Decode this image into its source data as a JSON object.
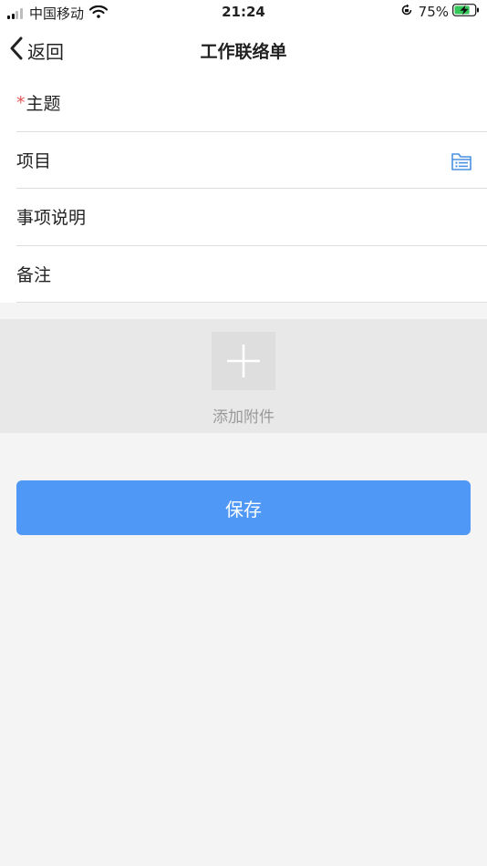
{
  "status_bar": {
    "carrier": "中国移动",
    "time": "21:24",
    "battery_percent": "75%",
    "battery_level": 0.75,
    "icons": [
      "signal-icon",
      "wifi-icon",
      "rotation-lock-icon",
      "battery-charging-icon"
    ]
  },
  "nav": {
    "back_label": "返回",
    "title": "工作联络单"
  },
  "form": {
    "subject": {
      "required_mark": "*",
      "label": "主题"
    },
    "project": {
      "label": "项目",
      "icon": "list-file-icon"
    },
    "description": {
      "label": "事项说明"
    },
    "remarks": {
      "label": "备注"
    }
  },
  "attachment": {
    "label": "添加附件",
    "icon": "plus-icon"
  },
  "actions": {
    "save_label": "保存"
  },
  "colors": {
    "accent": "#5098f5",
    "background": "#f4f4f4",
    "attach_bg": "#e8e8e8",
    "required": "#e05656"
  }
}
